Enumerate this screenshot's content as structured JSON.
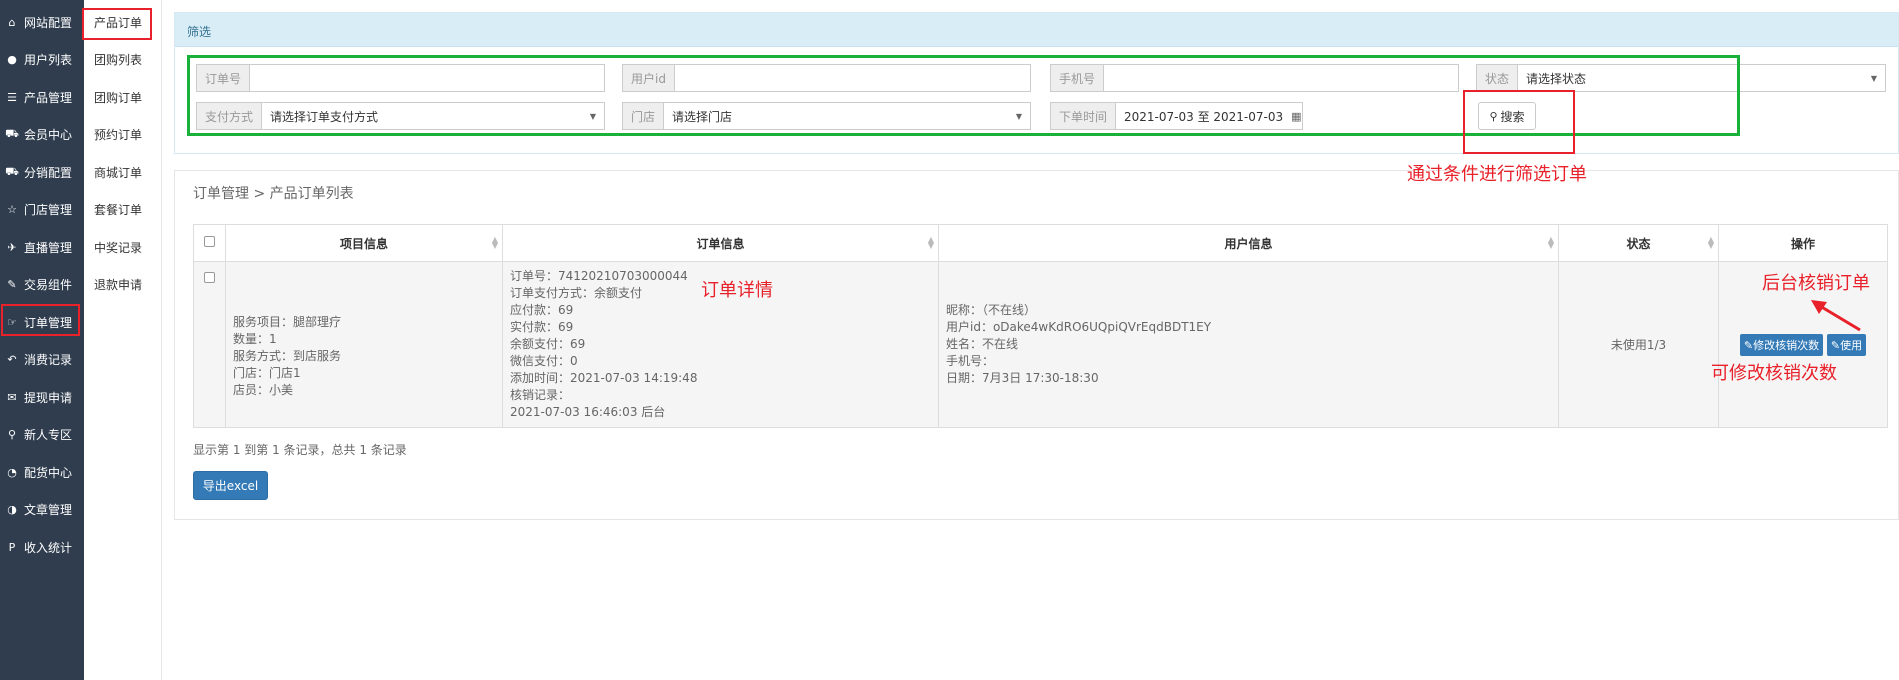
{
  "sidebar": {
    "items": [
      {
        "icon": "home-icon",
        "glyph": "⌂",
        "label": "网站配置"
      },
      {
        "icon": "user-icon",
        "glyph": "●",
        "label": "用户列表"
      },
      {
        "icon": "list-icon",
        "glyph": "☰",
        "label": "产品管理"
      },
      {
        "icon": "cart-icon",
        "glyph": "⛟",
        "label": "会员中心"
      },
      {
        "icon": "cart-icon",
        "glyph": "⛟",
        "label": "分销配置"
      },
      {
        "icon": "star-icon",
        "glyph": "☆",
        "label": "门店管理"
      },
      {
        "icon": "plane-icon",
        "glyph": "✈",
        "label": "直播管理"
      },
      {
        "icon": "pencil-icon",
        "glyph": "✎",
        "label": "交易组件"
      },
      {
        "icon": "hand-icon",
        "glyph": "☞",
        "label": "订单管理"
      },
      {
        "icon": "reply-icon",
        "glyph": "↶",
        "label": "消费记录"
      },
      {
        "icon": "comments-icon",
        "glyph": "✉",
        "label": "提现申请"
      },
      {
        "icon": "map-marker-icon",
        "glyph": "⚲",
        "label": "新人专区"
      },
      {
        "icon": "pie-chart-icon",
        "glyph": "◔",
        "label": "配货中心"
      },
      {
        "icon": "contrast-icon",
        "glyph": "◑",
        "label": "文章管理"
      },
      {
        "icon": "paypal-icon",
        "glyph": "P",
        "label": "收入统计"
      }
    ]
  },
  "subnav": {
    "items": [
      "产品订单",
      "团购列表",
      "团购订单",
      "预约订单",
      "商城订单",
      "套餐订单",
      "中奖记录",
      "退款申请"
    ]
  },
  "filter": {
    "title": "筛选",
    "order_no_label": "订单号",
    "order_no_value": "",
    "user_id_label": "用户id",
    "user_id_value": "",
    "phone_label": "手机号",
    "phone_value": "",
    "status_label": "状态",
    "status_value": "请选择状态",
    "pay_label": "支付方式",
    "pay_value": "请选择订单支付方式",
    "store_label": "门店",
    "store_value": "请选择门店",
    "time_label": "下单时间",
    "time_value": "2021-07-03 至 2021-07-03",
    "search_label": "搜索"
  },
  "breadcrumb": "订单管理 > 产品订单列表",
  "table": {
    "headers": [
      "项目信息",
      "订单信息",
      "用户信息",
      "状态",
      "操作"
    ],
    "row": {
      "project": [
        "服务项目：腿部理疗",
        "数量：1",
        "服务方式：到店服务",
        "门店：门店1",
        "店员：小美"
      ],
      "order": [
        "订单号：74120210703000044",
        "订单支付方式：余额支付",
        "应付款：69",
        "实付款：69",
        "余额支付：69",
        "微信支付：0",
        "添加时间：2021-07-03 14:19:48",
        "核销记录：",
        "2021-07-03 16:46:03 后台"
      ],
      "user": [
        "昵称：（不在线）",
        "用户id：oDake4wKdRO6UQpiQVrEqdBDT1EY",
        "姓名：不在线",
        "手机号：",
        "日期：7月3日 17:30-18:30"
      ],
      "status": "未使用1/3",
      "edit_btn": "修改核销次数",
      "use_btn": "使用"
    }
  },
  "footer": {
    "info": "显示第 1 到第 1 条记录，总共 1 条记录",
    "export_label": "导出excel"
  },
  "annotations": {
    "filter_note": "通过条件进行筛选订单",
    "detail_note": "订单详情",
    "verify_note": "后台核销订单",
    "edit_note": "可修改核销次数"
  },
  "colors": {
    "sidebar_bg": "#2f3d4e",
    "accent": "#337ab7",
    "annotation_red": "#e8212a",
    "annotation_green": "#19b13a"
  }
}
